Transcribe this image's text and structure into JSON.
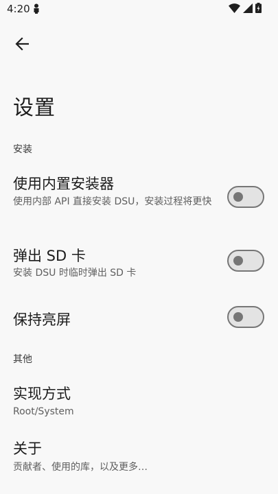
{
  "status_bar": {
    "time": "4:20",
    "left_icon": "person-icon",
    "right_icons": [
      "wifi-icon",
      "signal-icon",
      "battery-icon"
    ]
  },
  "app_bar": {
    "back_icon": "arrow-back-icon"
  },
  "title": "设置",
  "sections": [
    {
      "header": "安装",
      "items": [
        {
          "title": "使用内置安装器",
          "summary": "使用内部 API 直接安装 DSU，安装过程将更快",
          "toggle": false
        },
        {
          "title": "弹出 SD 卡",
          "summary": "安装 DSU 时临时弹出 SD 卡",
          "toggle": false
        },
        {
          "title": "保持亮屏",
          "summary": "",
          "toggle": false
        }
      ]
    },
    {
      "header": "其他",
      "items": [
        {
          "title": "实现方式",
          "summary": "Root/System"
        },
        {
          "title": "关于",
          "summary": "贡献者、使用的库，以及更多…"
        }
      ]
    }
  ],
  "colors": {
    "background": "#f8f8f8",
    "text_primary": "#1c1c1c",
    "text_secondary": "#5e5e5e",
    "toggle_outline": "#767676",
    "toggle_track": "#e3e3e3"
  }
}
